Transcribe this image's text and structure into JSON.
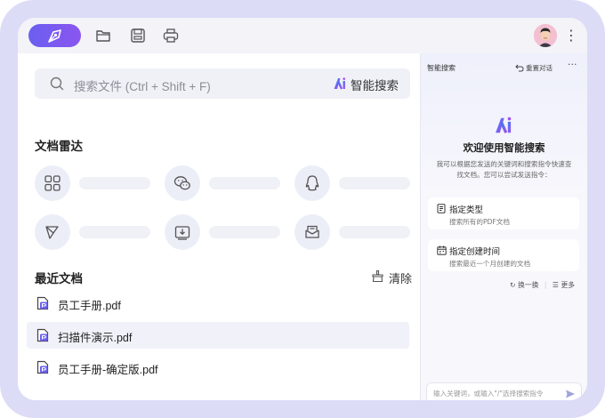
{
  "left_panel": {
    "search": {
      "placeholder": "搜索文件 (Ctrl + Shift + F)",
      "ai_button_label": "智能搜索"
    },
    "radar": {
      "title": "文档雷达",
      "items": [
        {
          "icon": "grid-icon"
        },
        {
          "icon": "wechat-icon"
        },
        {
          "icon": "qq-icon"
        },
        {
          "icon": "feishu-icon"
        },
        {
          "icon": "download-icon"
        },
        {
          "icon": "mail-icon"
        }
      ]
    },
    "recent": {
      "title": "最近文档",
      "clear_label": "清除",
      "files": [
        {
          "name": "员工手册.pdf",
          "selected": false
        },
        {
          "name": "扫描件演示.pdf",
          "selected": true
        },
        {
          "name": "员工手册-确定版.pdf",
          "selected": false
        }
      ]
    }
  },
  "right_panel": {
    "title": "智能搜索",
    "reset_label": "重置对话",
    "welcome_title": "欢迎使用智能搜索",
    "intro": "我可以根据您发送的关键词和搜索指令快速查找文档。您可以尝试发送指令：",
    "suggestions": [
      {
        "title": "指定类型",
        "subtitle": "搜索所有的PDF文档",
        "icon": "document-icon"
      },
      {
        "title": "指定创建时间",
        "subtitle": "搜索最近一个月创建的文档",
        "icon": "calendar-icon"
      }
    ],
    "refresh_label": "换一换",
    "more_label": "更多",
    "input_placeholder": "输入关键词，或输入\"/\"选择搜索指令"
  },
  "colors": {
    "accent": "#6b5ff0",
    "frame": "#dcdcf7",
    "window_bg": "#ffffff",
    "titlebar_bg": "#f3f3f8"
  }
}
